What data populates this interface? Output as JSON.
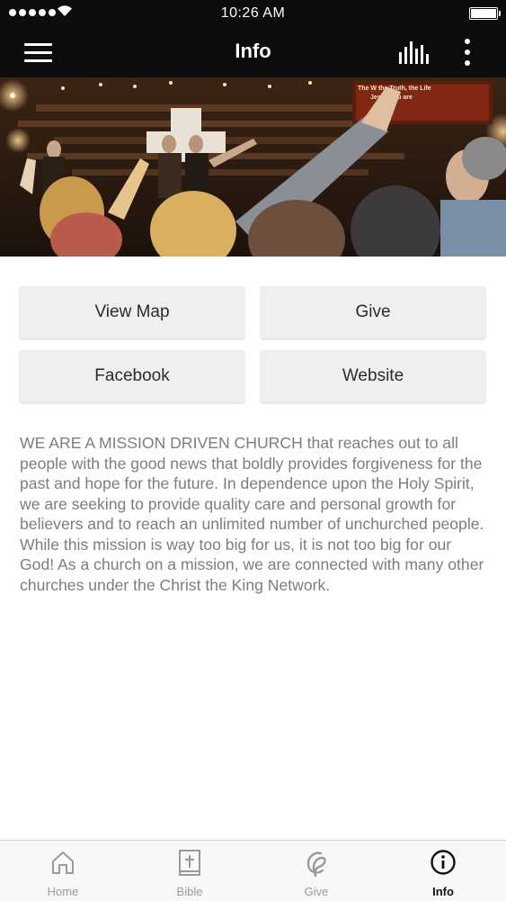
{
  "status_bar": {
    "time": "10:26 AM"
  },
  "nav": {
    "title": "Info"
  },
  "hero": {
    "screen_text_line1": "The W   the Truth, the Life",
    "screen_text_line2": "Jesus You are"
  },
  "actions": {
    "view_map": "View Map",
    "give": "Give",
    "facebook": "Facebook",
    "website": "Website"
  },
  "description": "WE ARE A MISSION DRIVEN CHURCH that reaches out to all people with the good news that boldly provides forgiveness for the past and hope for the future. In dependence upon the Holy Spirit, we are seeking to provide quality care and personal growth for believers and to reach an unlimited number of unchurched people. While this mission is way too big for us, it is not too big for our God! As a church on a mission, we are connected with many other churches under the Christ the King Network.",
  "tabs": [
    {
      "label": "Home",
      "icon": "home-icon"
    },
    {
      "label": "Bible",
      "icon": "bible-icon"
    },
    {
      "label": "Give",
      "icon": "give-icon"
    },
    {
      "label": "Info",
      "icon": "info-icon",
      "active": true
    }
  ],
  "colors": {
    "bar_background": "#0c0c0c",
    "button_background": "#efefef",
    "description_text": "#7d7d7d",
    "tab_inactive": "#9a9a9a",
    "tab_active": "#111111"
  }
}
